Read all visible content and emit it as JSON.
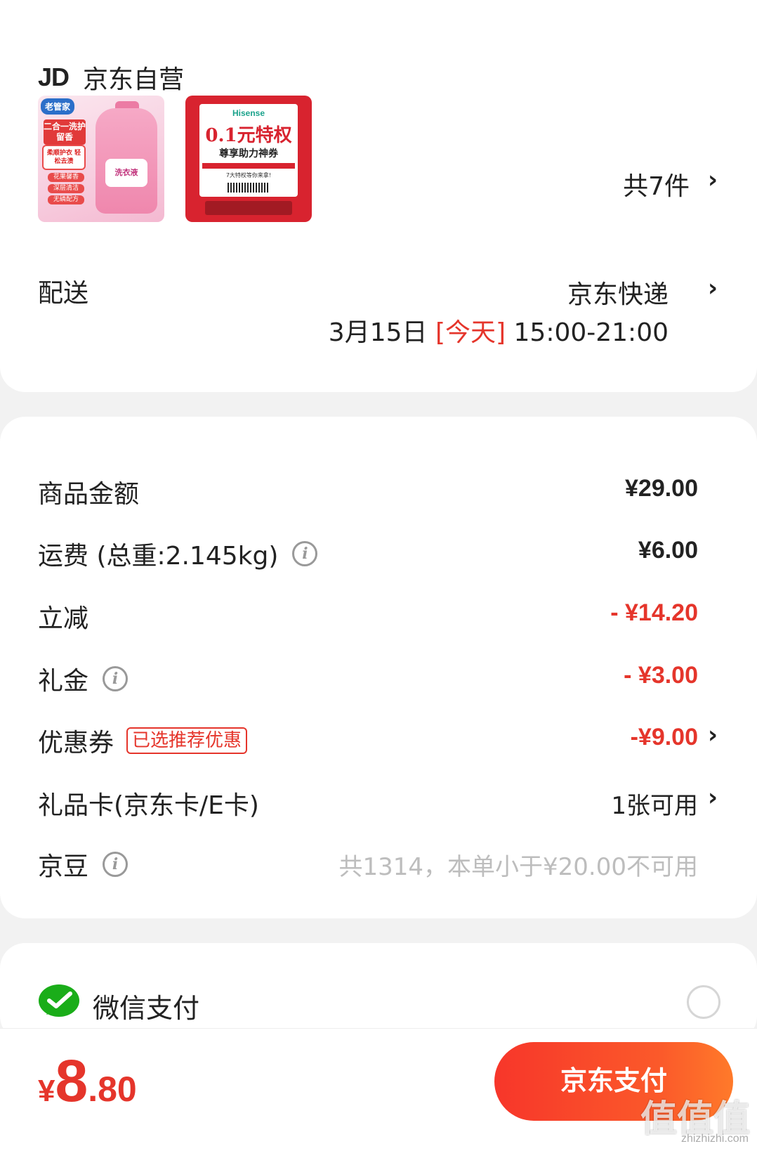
{
  "store": {
    "logo_text": "JD",
    "name": "京东自营"
  },
  "products": {
    "thumb1": {
      "brand": "老管家",
      "tag": "二合一洗护留香",
      "box": "柔顺护衣 轻松去渍",
      "pills": [
        "花果馨香",
        "深层清洁",
        "无磷配方"
      ],
      "label": "洗衣液"
    },
    "thumb2": {
      "brand": "Hisense",
      "title": "0.1元特权",
      "subtitle": "尊享助力神券",
      "note": "7大特权等你来拿!"
    },
    "count_label": "共7件"
  },
  "delivery": {
    "label": "配送",
    "method": "京东快递",
    "date": "3月15日",
    "today": "[今天]",
    "time": "15:00-21:00"
  },
  "price_rows": {
    "goods": {
      "label": "商品金额",
      "value": "¥29.00"
    },
    "shipping": {
      "label": "运费 (总重:2.145kg)",
      "value": "¥6.00"
    },
    "discount": {
      "label": "立减",
      "value": "- ¥14.20"
    },
    "gift_money": {
      "label": "礼金",
      "value": "- ¥3.00"
    },
    "coupon": {
      "label": "优惠券",
      "badge": "已选推荐优惠",
      "value": "-¥9.00"
    },
    "gift_card": {
      "label": "礼品卡(京东卡/E卡)",
      "value": "1张可用"
    },
    "jd_beans": {
      "label": "京豆",
      "value": "共1314，本单小于¥20.00不可用"
    }
  },
  "payment": {
    "method": "微信支付"
  },
  "footer": {
    "currency": "¥",
    "total_int": "8",
    "total_dec": ".80",
    "pay_button": "京东支付"
  },
  "watermark": {
    "text": "值值值",
    "url": "zhizhizhi.com"
  },
  "colors": {
    "accent_red": "#e5352b",
    "wechat_green": "#1aad19",
    "background": "#f2f2f2"
  }
}
